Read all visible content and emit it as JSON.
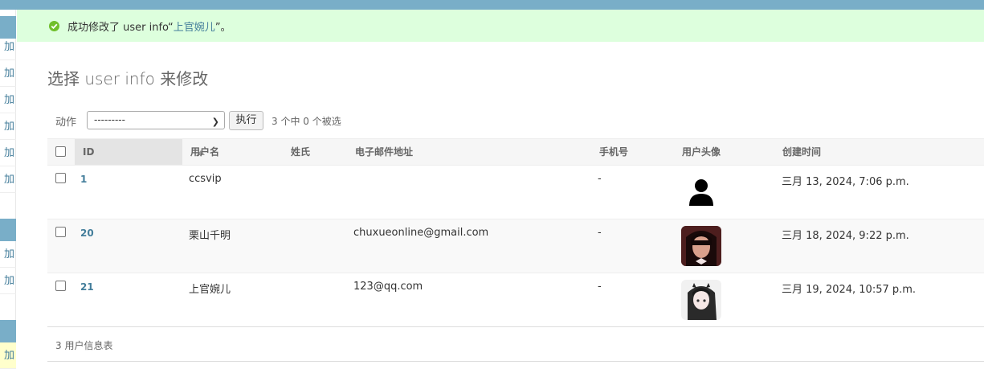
{
  "sidebar": {
    "add_label": "加"
  },
  "message": {
    "prefix": "成功修改了 user info“",
    "link": "上官婉儿",
    "suffix": "”。"
  },
  "page_title": "选择 user info 来修改",
  "actions": {
    "label": "动作",
    "select_value": "---------",
    "go_label": "执行",
    "counter": "3 个中 0 个被选"
  },
  "table": {
    "columns": [
      "ID",
      "用户名",
      "姓氏",
      "电子邮件地址",
      "手机号",
      "用户头像",
      "创建时间"
    ],
    "rows": [
      {
        "id": "1",
        "username": "ccsvip",
        "last_name": "",
        "email": "",
        "phone": "-",
        "avatar": "person-silhouette-icon",
        "created": "三月 13, 2024, 7:06 p.m."
      },
      {
        "id": "20",
        "username": "栗山千明",
        "last_name": "",
        "email": "chuxueonline@gmail.com",
        "phone": "-",
        "avatar": "photo-avatar",
        "created": "三月 18, 2024, 9:22 p.m."
      },
      {
        "id": "21",
        "username": "上官婉儿",
        "last_name": "",
        "email": "123@qq.com",
        "phone": "-",
        "avatar": "anime-avatar",
        "created": "三月 19, 2024, 10:57 p.m."
      }
    ]
  },
  "paginator": "3 用户信息表",
  "colors": {
    "header": "#79aec8",
    "link": "#447e9b",
    "success_bg": "#dddddd"
  }
}
